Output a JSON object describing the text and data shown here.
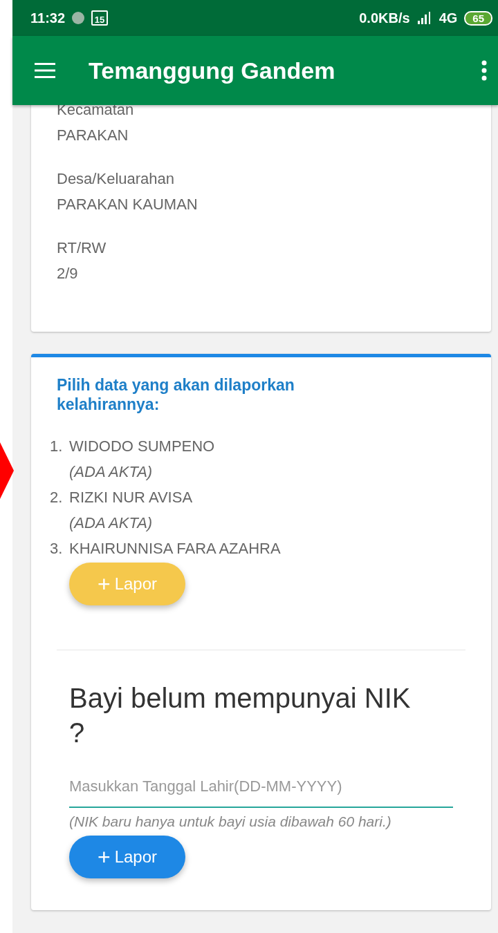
{
  "status_bar": {
    "time": "11:32",
    "calendar_day": "15",
    "speed": "0.0KB/s",
    "network": "4G",
    "battery": "65"
  },
  "app_bar": {
    "title": "Temanggung Gandem"
  },
  "address_card": {
    "fields": [
      {
        "label": "Kecamatan",
        "value": "PARAKAN"
      },
      {
        "label": "Desa/Keluarahan",
        "value": "PARAKAN KAUMAN"
      },
      {
        "label": "RT/RW",
        "value": "2/9"
      }
    ]
  },
  "birth_card": {
    "heading": "Pilih data yang akan dilaporkan kelahirannya:",
    "people": [
      {
        "number": "1.",
        "name": "WIDODO SUMPENO",
        "note": "(ADA AKTA)"
      },
      {
        "number": "2.",
        "name": "RIZKI NUR AVISA",
        "note": "(ADA AKTA)"
      },
      {
        "number": "3.",
        "name": "KHAIRUNNISA FARA AZAHRA"
      }
    ],
    "report_button": {
      "icon": "+",
      "label": "Lapor"
    },
    "no_nik_title": "Bayi belum mempunyai NIK ?",
    "date_field": {
      "placeholder": "Masukkan Tanggal Lahir(DD-MM-YYYY)"
    },
    "hint": "(NIK baru hanya untuk bayi usia dibawah 60 hari.)",
    "new_report_button": {
      "icon": "+",
      "label": "Lapor"
    }
  }
}
